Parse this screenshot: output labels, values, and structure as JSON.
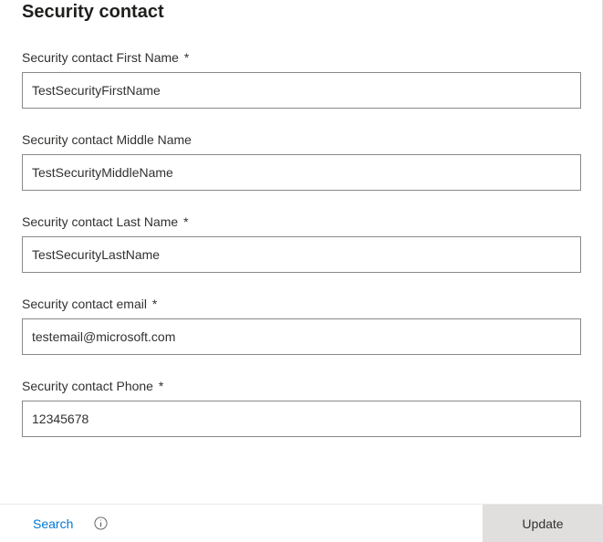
{
  "title": "Security contact",
  "required_marker": "*",
  "fields": {
    "first_name": {
      "label": "Security contact First Name",
      "value": "TestSecurityFirstName",
      "required": true
    },
    "middle_name": {
      "label": "Security contact Middle Name",
      "value": "TestSecurityMiddleName",
      "required": false
    },
    "last_name": {
      "label": "Security contact Last Name",
      "value": "TestSecurityLastName",
      "required": true
    },
    "email": {
      "label": "Security contact email",
      "value": "testemail@microsoft.com",
      "required": true
    },
    "phone": {
      "label": "Security contact Phone",
      "value": "12345678",
      "required": true
    }
  },
  "footer": {
    "search_label": "Search",
    "update_label": "Update"
  }
}
